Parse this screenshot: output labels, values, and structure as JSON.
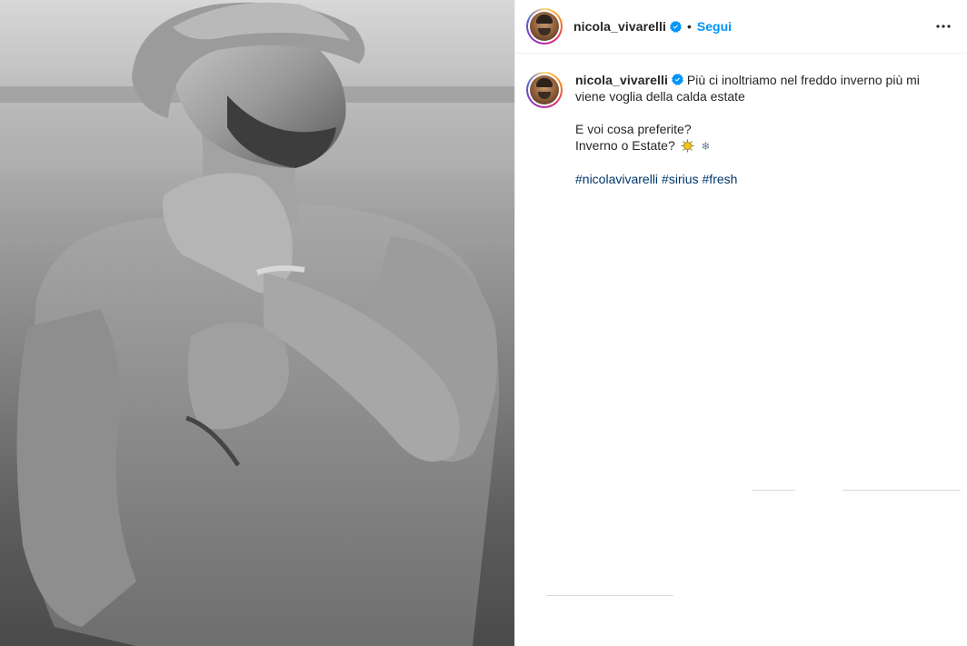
{
  "post": {
    "username": "nicola_vivarelli",
    "verified": true,
    "separator": "•",
    "follow_label": "Segui",
    "more_label": "⋯"
  },
  "caption": {
    "username": "nicola_vivarelli",
    "line1": "Più ci inoltriamo nel freddo inverno più mi viene voglia della calda estate",
    "line2": "E voi cosa preferite?",
    "line3": "Inverno o Estate?",
    "emoji_snow": "❄",
    "hashtags": [
      "#nicolavivarelli",
      "#sirius",
      "#fresh"
    ]
  },
  "icons": {
    "verified": "verified-badge-icon",
    "more": "more-options-icon",
    "sun": "sun-emoji-icon",
    "snow": "snowflake-emoji-icon"
  },
  "colors": {
    "accent": "#0095f6",
    "hashtag": "#00376b",
    "text": "#262626",
    "divider": "#efefef"
  }
}
